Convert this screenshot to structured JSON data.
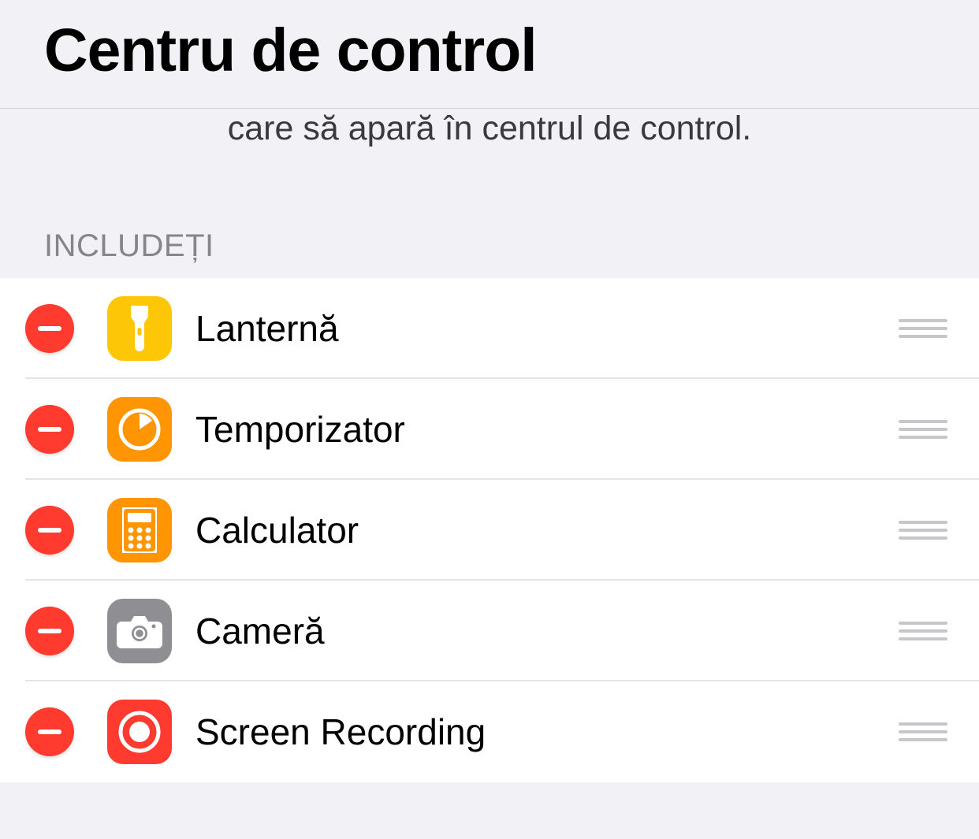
{
  "header": {
    "title": "Centru de control"
  },
  "subtitle": "care să apară în centrul de control.",
  "section": {
    "include_label": "INCLUDEȚI"
  },
  "items": [
    {
      "label": "Lanternă",
      "icon": "flashlight"
    },
    {
      "label": "Temporizator",
      "icon": "timer"
    },
    {
      "label": "Calculator",
      "icon": "calculator"
    },
    {
      "label": "Cameră",
      "icon": "camera"
    },
    {
      "label": "Screen Recording",
      "icon": "screen-recording"
    }
  ]
}
